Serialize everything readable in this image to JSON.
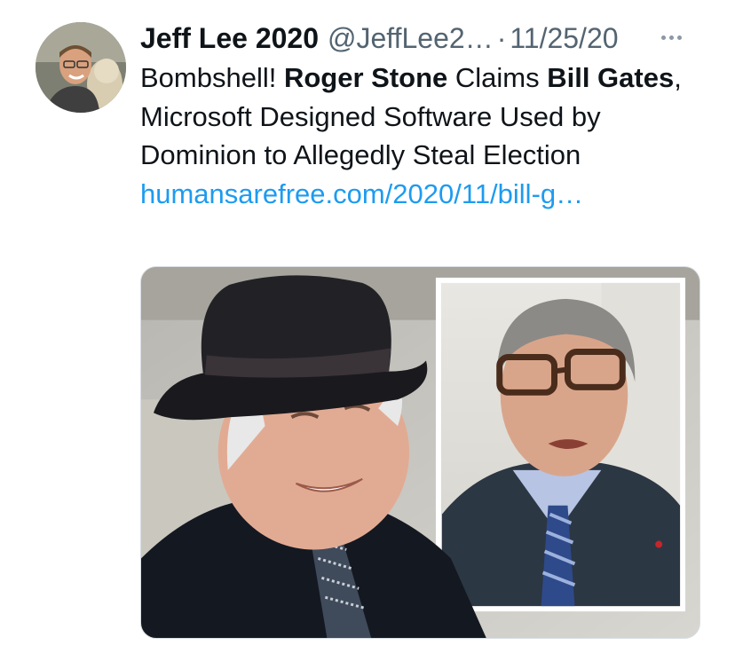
{
  "tweet": {
    "author": {
      "display_name": "Jeff Lee 2020",
      "handle": "@JeffLee2…",
      "avatar_icon": "profile-photo"
    },
    "separator": "·",
    "date": "11/25/20",
    "more_icon": "ellipsis-icon",
    "text": {
      "part1": "Bombshell! ",
      "bold1": "Roger Stone",
      "part2": " Claims ",
      "bold2": "Bill Gates",
      "part3": ", Microsoft Designed Software Used by Dominion to Allegedly Steal Election ",
      "link": "humansarefree.com/2020/11/bill-g…"
    },
    "media": {
      "type": "photo",
      "description_icon": "news-photo"
    }
  },
  "colors": {
    "text": "#0f1419",
    "secondary": "#536471",
    "link": "#1d9bf0",
    "background": "#ffffff"
  }
}
